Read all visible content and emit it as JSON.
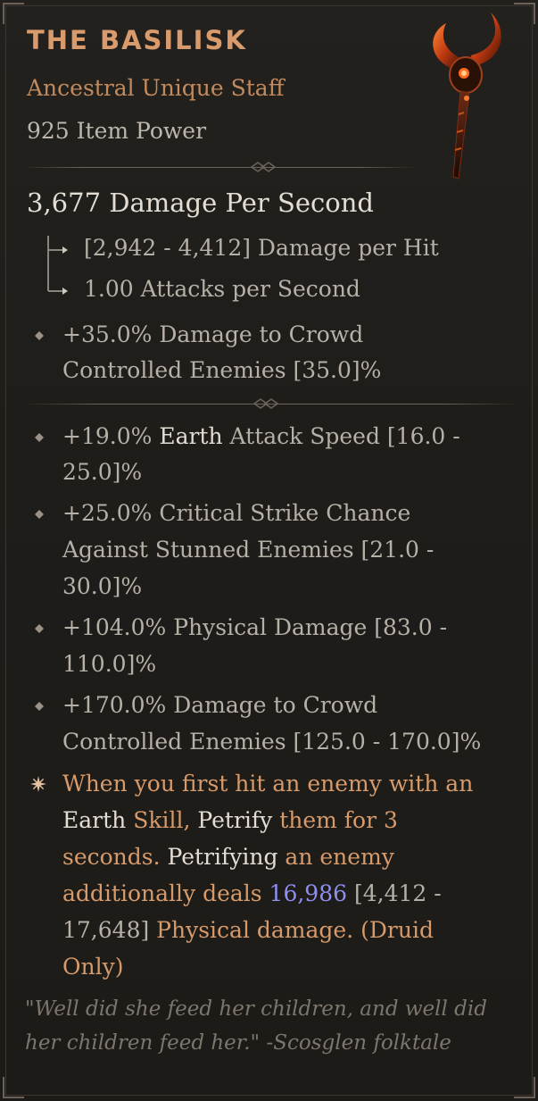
{
  "item": {
    "name": "THE BASILISK",
    "type_line": "Ancestral Unique Staff",
    "item_power": "925 Item Power",
    "image_icon": "unique-staff-icon"
  },
  "offense": {
    "dps": "3,677 Damage Per Second",
    "damage_per_hit": "[2,942 - 4,412] Damage per Hit",
    "attacks_per_second": "1.00 Attacks per Second"
  },
  "implicit": {
    "line1": "+35.0% Damage to Crowd",
    "line2": "Controlled Enemies [35.0]%"
  },
  "affixes": [
    {
      "value": "+19.0% ",
      "keyword": "Earth",
      "rest": " Attack Speed  [16.0 -",
      "line2": "25.0]%"
    },
    {
      "line1": "+25.0% Critical Strike Chance",
      "line2": "Against Stunned Enemies [21.0 -",
      "line3": "30.0]%"
    },
    {
      "line1": "+104.0% Physical Damage [83.0 -",
      "line2": "110.0]%"
    },
    {
      "line1": "+170.0% Damage to Crowd",
      "line2": "Controlled Enemies [125.0 - 170.0]%"
    }
  ],
  "unique_power": {
    "line1": "When you first hit an enemy with an",
    "line2_a": "Earth",
    "line2_b": " Skill, ",
    "line2_c": "Petrify",
    "line2_d": " them for 3",
    "line3_a": "seconds. ",
    "line3_b": "Petrifying",
    "line3_c": " an enemy",
    "line4_a": "additionally deals ",
    "line4_b": "16,986",
    "line4_c": " [4,412 -",
    "line5": "17,648] Physical damage. (Druid",
    "line6": "Only)"
  },
  "flavor": {
    "line1": "\"Well did she feed her children, and well did",
    "line2": "her children feed her.\" -Scosglen folktale"
  },
  "colors": {
    "title": "#d99a6c",
    "unique_text": "#d69a6b",
    "stat_text": "#b7b0a7",
    "highlight": "#e4ddd4",
    "value_purple": "#8f8ff0",
    "flavor": "#7d766d"
  }
}
